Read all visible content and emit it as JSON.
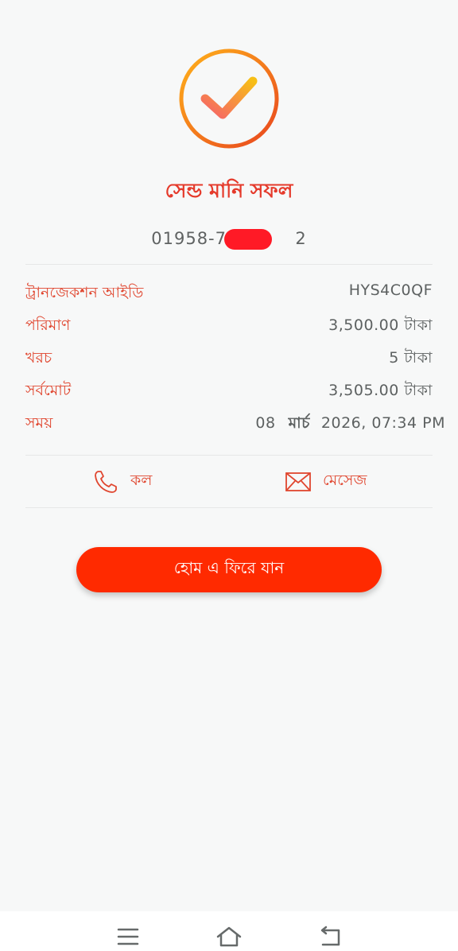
{
  "status": {
    "title": "সেন্ড মানি সফল",
    "icon": "check-circle-icon",
    "accent_color": "#e53a2b",
    "icon_gradient": [
      "#ffb21a",
      "#e8451f"
    ]
  },
  "recipient": {
    "phone_visible": "01958-70",
    "phone_suffix": "2",
    "masked": true,
    "mask_color": "#ff1a26"
  },
  "details": [
    {
      "label": "ট্রানজেকশন আইডি",
      "value": "HYS4C0QF"
    },
    {
      "label": "পরিমাণ",
      "value": "3,500.00 টাকা"
    },
    {
      "label": "খরচ",
      "value": "5 টাকা"
    },
    {
      "label": "সর্বমোট",
      "value": "3,505.00 টাকা"
    }
  ],
  "time": {
    "label": "সময়",
    "day": "08",
    "month": "মার্চ",
    "rest": "2026, 07:34 PM"
  },
  "actions": {
    "call": {
      "label": "কল",
      "icon": "phone-icon"
    },
    "message": {
      "label": "মেসেজ",
      "icon": "envelope-icon"
    }
  },
  "home_button": {
    "label": "হোম এ ফিরে যান",
    "color": "#ff2a00"
  },
  "navbar": {
    "icons": [
      "menu-icon",
      "home-icon",
      "back-icon"
    ]
  }
}
